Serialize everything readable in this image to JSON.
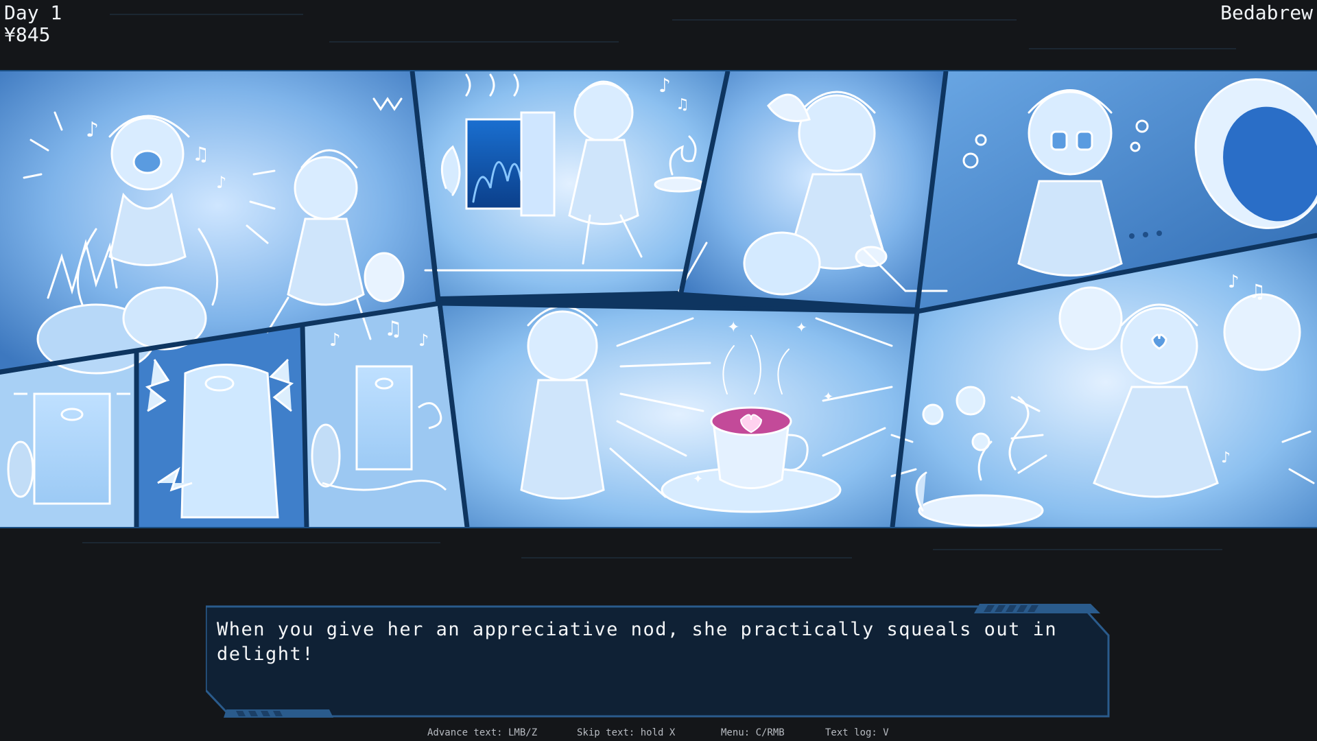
{
  "hud": {
    "day": "Day 1",
    "money": "¥845",
    "location": "Bedabrew"
  },
  "comic": {
    "panel_count": 11,
    "theme_color": "#4f93d8",
    "line_color": "#ffffff"
  },
  "dialog": {
    "text": "When you give her an appreciative nod, she practically squeals out in delight!"
  },
  "controls": {
    "advance": "Advance text: LMB/Z",
    "skip": "Skip text: hold X",
    "menu": "Menu: C/RMB",
    "log": "Text log: V"
  },
  "colors": {
    "background": "#141619",
    "dialog_fill": "#0f2135",
    "dialog_border": "#2a5b8c",
    "accent": "#3f7ec2"
  }
}
